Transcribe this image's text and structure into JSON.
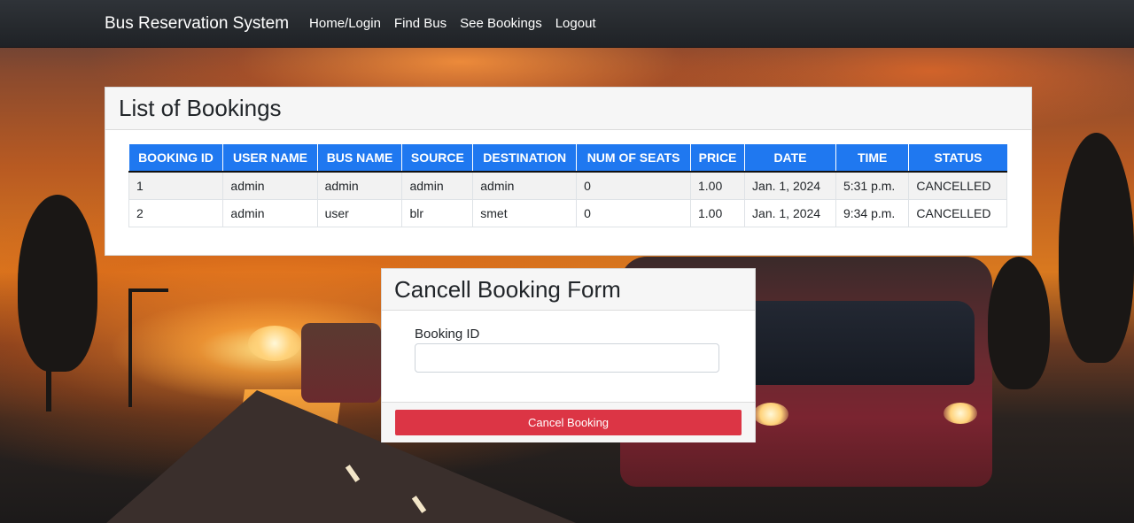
{
  "navbar": {
    "brand": "Bus Reservation System",
    "links": [
      "Home/Login",
      "Find Bus",
      "See Bookings",
      "Logout"
    ]
  },
  "bookings": {
    "title": "List of Bookings",
    "columns": [
      "BOOKING ID",
      "USER NAME",
      "BUS NAME",
      "SOURCE",
      "DESTINATION",
      "NUM OF SEATS",
      "PRICE",
      "DATE",
      "TIME",
      "STATUS"
    ],
    "rows": [
      [
        "1",
        "admin",
        "admin",
        "admin",
        "admin",
        "0",
        "1.00",
        "Jan. 1, 2024",
        "5:31 p.m.",
        "CANCELLED"
      ],
      [
        "2",
        "admin",
        "user",
        "blr",
        "smet",
        "0",
        "1.00",
        "Jan. 1, 2024",
        "9:34 p.m.",
        "CANCELLED"
      ]
    ]
  },
  "cancel_form": {
    "title": "Cancell Booking Form",
    "field_label": "Booking ID",
    "field_value": "",
    "button_label": "Cancel Booking"
  },
  "colors": {
    "navbar": "#1f2226",
    "table_header": "#1f78f0",
    "cancel_button": "#dc3545"
  }
}
